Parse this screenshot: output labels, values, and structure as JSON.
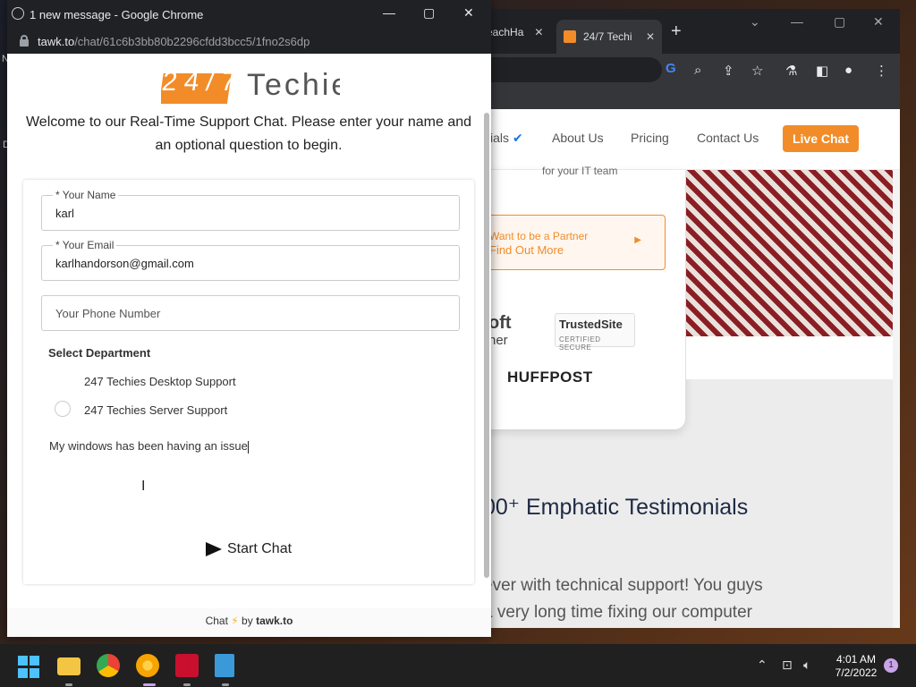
{
  "desktop": {
    "left_char_1": "N",
    "left_char_2": "D"
  },
  "bg_browser": {
    "tab1_label": "eachHa",
    "tab2_label": "24/7 Techi",
    "nav": {
      "item1": "ials",
      "item2": "About Us",
      "item3": "Pricing",
      "item4": "Contact Us",
      "cta": "Live Chat"
    },
    "card": {
      "subtitle": "for your IT team",
      "partner_line1": "Want to be a Partner",
      "partner_line2": "Find Out More",
      "logo_ms_1": "oft",
      "logo_ms_2": "ner",
      "trusted_title": "TrustedSite",
      "trusted_sub": "CERTIFIED SECURE",
      "huffpost": "HUFFPOST"
    },
    "testimonials_heading": "00⁺ Emphatic Testimonials",
    "testimonials_line1": "ever with technical support! You guys",
    "testimonials_line2": "a very long time fixing our computer"
  },
  "popup": {
    "window_title": "1 new message - Google Chrome",
    "url_domain": "tawk.to",
    "url_path": "/chat/61c6b3bb80b2296cfdd3bcc5/1fno2s6dp",
    "logo_num": "24/7",
    "logo_text": "Techies",
    "welcome_text": "Welcome to our Real-Time Support Chat. Please enter your name and an optional question to begin.",
    "form": {
      "name_label": "* Your Name",
      "name_value": "karl",
      "email_label": "* Your Email",
      "email_value": "karlhandorson@gmail.com",
      "phone_placeholder": "Your Phone Number",
      "dept_label": "Select Department",
      "dept_options": [
        "247 Techies Desktop Support",
        "247 Techies Server Support"
      ],
      "message_value": "My windows has been having an issue",
      "submit_label": "Start Chat"
    },
    "footer_chat": "Chat",
    "footer_by": "by",
    "footer_brand": "tawk.to"
  },
  "taskbar": {
    "time": "4:01 AM",
    "date": "7/2/2022",
    "notification_count": "1"
  },
  "colors": {
    "accent": "#f28c28",
    "titlebar": "#202124",
    "taskbar": "#202020"
  }
}
